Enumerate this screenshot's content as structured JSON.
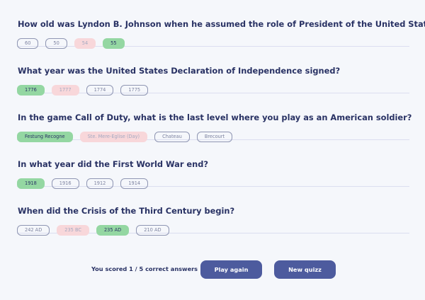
{
  "questions": [
    {
      "title": "How old was Lyndon B. Johnson when he assumed the role of President of the United States?",
      "answers": [
        {
          "label": "60",
          "state": "neutral"
        },
        {
          "label": "50",
          "state": "neutral"
        },
        {
          "label": "54",
          "state": "incorrect"
        },
        {
          "label": "55",
          "state": "correct"
        }
      ]
    },
    {
      "title": "What year was the United States Declaration of Independence signed?",
      "answers": [
        {
          "label": "1776",
          "state": "correct"
        },
        {
          "label": "1777",
          "state": "incorrect"
        },
        {
          "label": "1774",
          "state": "neutral"
        },
        {
          "label": "1775",
          "state": "neutral"
        }
      ]
    },
    {
      "title": "In the game Call of Duty, what is the last level where you play as an American soldier?",
      "answers": [
        {
          "label": "Festung Recogne",
          "state": "correct"
        },
        {
          "label": "Ste. Mere-Eglise (Day)",
          "state": "incorrect"
        },
        {
          "label": "Chateau",
          "state": "neutral"
        },
        {
          "label": "Brecourt",
          "state": "neutral"
        }
      ]
    },
    {
      "title": "In what year did the First World War end?",
      "answers": [
        {
          "label": "1918",
          "state": "correct"
        },
        {
          "label": "1916",
          "state": "neutral"
        },
        {
          "label": "1912",
          "state": "neutral"
        },
        {
          "label": "1914",
          "state": "neutral"
        }
      ]
    },
    {
      "title": "When did the Crisis of the Third Century begin?",
      "answers": [
        {
          "label": "242 AD",
          "state": "neutral"
        },
        {
          "label": "235 BC",
          "state": "incorrect"
        },
        {
          "label": "235 AD",
          "state": "correct"
        },
        {
          "label": "210 AD",
          "state": "neutral"
        }
      ]
    }
  ],
  "footer": {
    "score_text": "You scored 1 / 5 correct answers",
    "play_again_label": "Play again",
    "new_quiz_label": "New quizz"
  },
  "colors": {
    "background": "#f5f7fb",
    "text": "#293264",
    "correct": "#94d7a2",
    "incorrect": "#f8d7da",
    "button": "#4d5b9e"
  }
}
